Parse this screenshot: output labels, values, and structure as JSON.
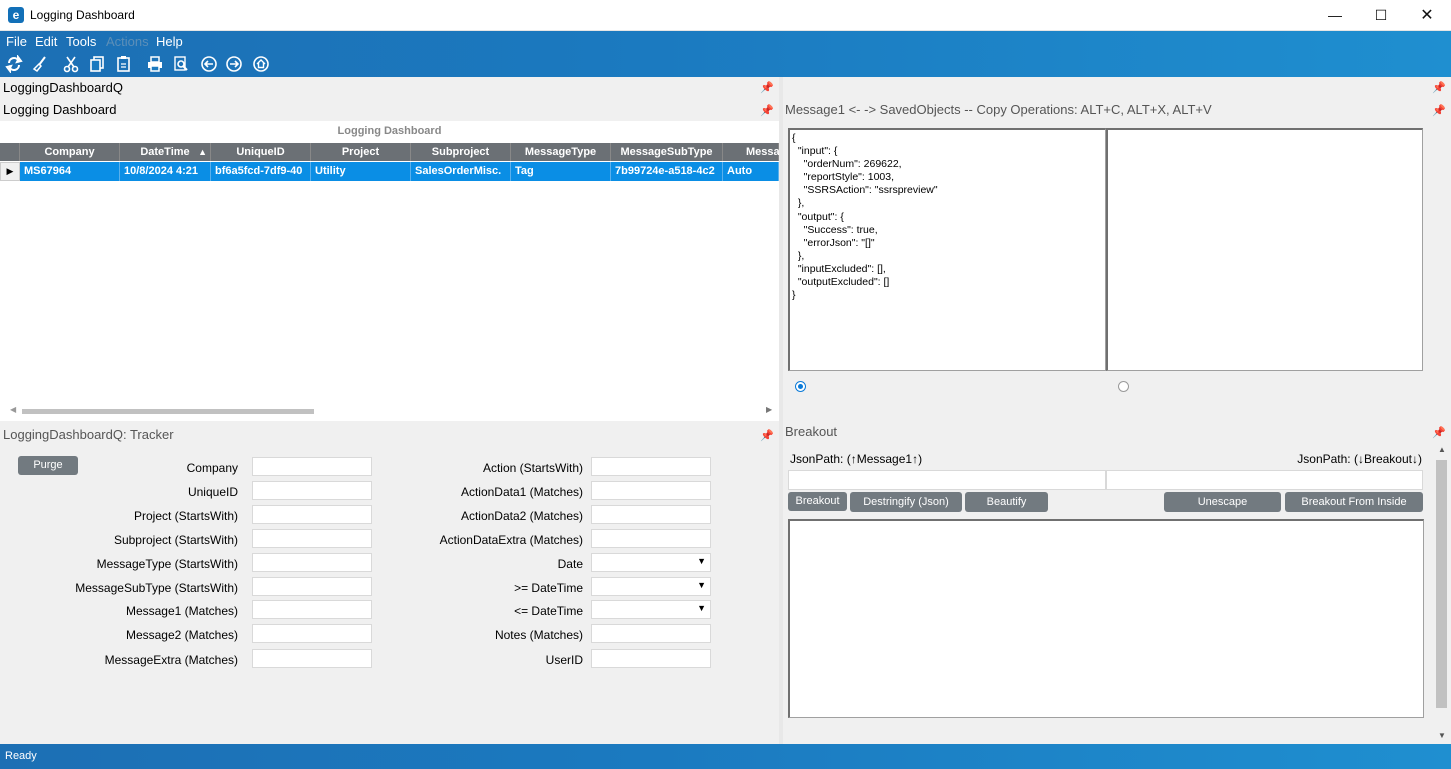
{
  "window": {
    "title": "Logging Dashboard",
    "logo_letter": "e"
  },
  "menu": [
    {
      "label": "File",
      "enabled": true
    },
    {
      "label": "Edit",
      "enabled": true
    },
    {
      "label": "Tools",
      "enabled": true
    },
    {
      "label": "Actions",
      "enabled": false
    },
    {
      "label": "Help",
      "enabled": true
    }
  ],
  "toolbar_icons": [
    "refresh-icon",
    "broom-icon",
    "cut-icon",
    "copy-icon",
    "paste-icon",
    "print-icon",
    "find-icon",
    "back-icon",
    "forward-icon",
    "home-icon"
  ],
  "panes": {
    "top_left": "LoggingDashboardQ",
    "grid_pane": "Logging Dashboard",
    "tracker": "LoggingDashboardQ: Tracker",
    "message": "Message1 <-  -> SavedObjects  --   Copy Operations:  ALT+C, ALT+X, ALT+V",
    "breakout": "Breakout"
  },
  "grid": {
    "caption": "Logging Dashboard",
    "columns": [
      "Company",
      "DateTime",
      "UniqueID",
      "Project",
      "Subproject",
      "MessageType",
      "MessageSubType",
      "Messa"
    ],
    "sorted_column": "DateTime",
    "rows": [
      [
        "MS67964",
        "10/8/2024 4:21",
        "bf6a5fcd-7df9-40",
        "Utility",
        "SalesOrderMisc.",
        "Tag",
        "7b99724e-a518-4c2",
        "Auto"
      ]
    ],
    "row_indicator": "▶"
  },
  "tracker": {
    "purge_label": "Purge",
    "left_fields": [
      {
        "label": "Company",
        "value": ""
      },
      {
        "label": "UniqueID",
        "value": ""
      },
      {
        "label": "Project (StartsWith)",
        "value": ""
      },
      {
        "label": "Subproject (StartsWith)",
        "value": ""
      },
      {
        "label": "MessageType (StartsWith)",
        "value": ""
      },
      {
        "label": "MessageSubType (StartsWith)",
        "value": ""
      },
      {
        "label": "Message1 (Matches)",
        "value": ""
      },
      {
        "label": "Message2 (Matches)",
        "value": ""
      },
      {
        "label": "MessageExtra (Matches)",
        "value": ""
      }
    ],
    "right_fields": [
      {
        "label": "Action (StartsWith)",
        "value": "",
        "type": "text"
      },
      {
        "label": "ActionData1 (Matches)",
        "value": "",
        "type": "text"
      },
      {
        "label": "ActionData2 (Matches)",
        "value": "",
        "type": "text"
      },
      {
        "label": "ActionDataExtra (Matches)",
        "value": "",
        "type": "text"
      },
      {
        "label": "Date",
        "value": "",
        "type": "dropdown"
      },
      {
        "label": ">= DateTime",
        "value": "",
        "type": "dropdown"
      },
      {
        "label": "<= DateTime",
        "value": "",
        "type": "dropdown"
      },
      {
        "label": "Notes (Matches)",
        "value": "",
        "type": "text"
      },
      {
        "label": "UserID",
        "value": "",
        "type": "text"
      }
    ]
  },
  "message": {
    "json_lines": [
      "{",
      "  \"input\": {",
      "    \"orderNum\": 269622,",
      "    \"reportStyle\": 1003,",
      "    \"SSRSAction\": \"ssrspreview\"",
      "  },",
      "  \"output\": {",
      "    \"Success\": true,",
      "    \"errorJson\": \"[]\"",
      "  },",
      "  \"inputExcluded\": [],",
      "  \"outputExcluded\": []",
      "}"
    ],
    "right_text": "",
    "selected_radio": "left"
  },
  "breakout": {
    "left_path_label": "JsonPath: (↑Message1↑)",
    "right_path_label": "JsonPath: (↓Breakout↓)",
    "left_path_value": "",
    "right_path_value": "",
    "buttons": {
      "breakout": "Breakout",
      "destringify": "Destringify (Json)",
      "beautify": "Beautify",
      "unescape": "Unescape",
      "breakout_inside": "Breakout From Inside"
    },
    "output": ""
  },
  "status": {
    "text": "Ready"
  },
  "colors": {
    "accent_blue": "#1b7ac0",
    "selection": "#0a8ee5",
    "header_gray": "#6b7075",
    "button_gray": "#727a80"
  }
}
